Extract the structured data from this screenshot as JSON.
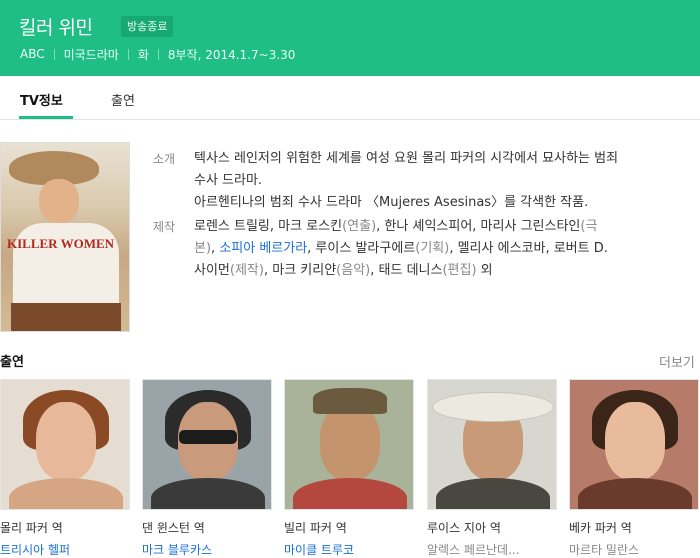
{
  "header": {
    "title": "킬러 위민",
    "badge": "방송종료",
    "meta": [
      "ABC",
      "미국드라마",
      "화",
      "8부작, 2014.1.7~3.30"
    ]
  },
  "tabs": [
    {
      "label": "TV정보",
      "active": true
    },
    {
      "label": "출연",
      "active": false
    }
  ],
  "poster": {
    "title_text": "KILLER WOMEN"
  },
  "info": {
    "intro_label": "소개",
    "intro_line1": "텍사스 레인저의 위험한 세계를 여성 요원 몰리 파커의 시각에서 묘사하는 범죄",
    "intro_line2": "수사 드라마.",
    "intro_line3": "아르헨티나의 범죄 수사 드라마 〈Mujeres Asesinas〉를 각색한 작품.",
    "prod_label": "제작",
    "prod_line1a": "로렌스 트릴링, 마크 로스킨",
    "prod_line1b": "(연출)",
    "prod_line1c": ", 한나 셰익스피어, 마리사 그린스타인",
    "prod_line1d": "(극",
    "prod_line2a": "본)",
    "prod_line2b": ", ",
    "prod_line2link": "소피아 베르가라",
    "prod_line2c": ", 루이스 발라구에르",
    "prod_line2d": "(기획)",
    "prod_line2e": ", 멜리사 에스코바, 로버트 D.",
    "prod_line3a": "사이먼",
    "prod_line3b": "(제작)",
    "prod_line3c": ", 마크 키리얀",
    "prod_line3d": "(음악)",
    "prod_line3e": ", 태드 데니스",
    "prod_line3f": "(편집)",
    "prod_line3g": " 외"
  },
  "cast_section": {
    "heading": "출연",
    "more_label": "더보기"
  },
  "cast": [
    {
      "role": "몰리 파커 역",
      "actor": "트리시아 헬퍼",
      "actor_linked": true
    },
    {
      "role": "댄 윈스턴 역",
      "actor": "마크 블루카스",
      "actor_linked": true
    },
    {
      "role": "빌리 파커 역",
      "actor": "마이클 트루코",
      "actor_linked": true
    },
    {
      "role": "루이스 지아 역",
      "actor": "알렉스 페르난데...",
      "actor_linked": false
    },
    {
      "role": "베카 파커 역",
      "actor": "마르타 밀란스",
      "actor_linked": false
    }
  ],
  "colors": {
    "brand_green": "#1fbe85",
    "link_blue": "#1a6fd6"
  }
}
